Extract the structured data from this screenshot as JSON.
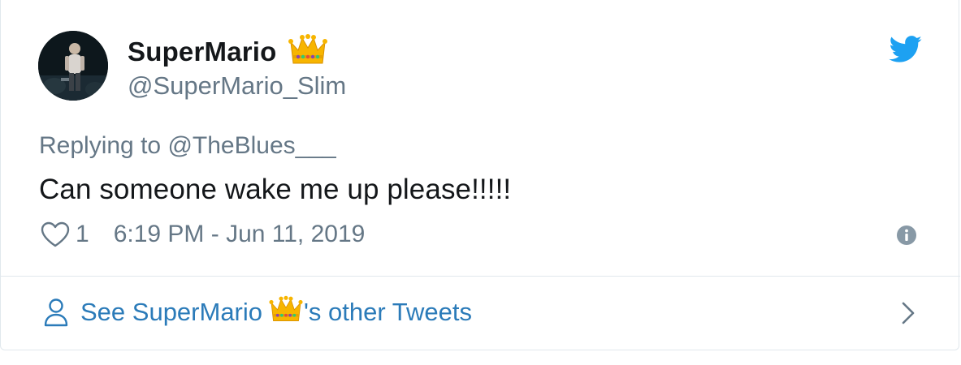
{
  "author": {
    "display_name": "SuperMario",
    "handle": "@SuperMario_Slim",
    "badge_icon": "crown-emoji"
  },
  "reply": {
    "prefix": "Replying to ",
    "target": "@TheBlues___"
  },
  "tweet": {
    "text": "Can someone wake me up please!!!!!"
  },
  "meta": {
    "like_count": "1",
    "timestamp": "6:19 PM - Jun 11, 2019"
  },
  "footer": {
    "prefix": "See SuperMario",
    "suffix": "'s other Tweets"
  },
  "colors": {
    "text_primary": "#14171a",
    "text_secondary": "#657786",
    "link": "#2b7bb9",
    "twitter_blue": "#1da1f2",
    "border": "#e1e8ed",
    "crown_gold": "#f7b500"
  }
}
